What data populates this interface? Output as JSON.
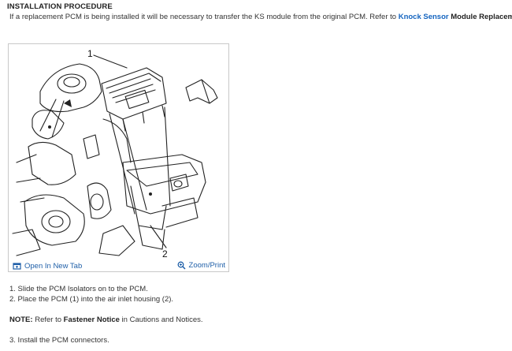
{
  "section": {
    "heading": "INSTALLATION PROCEDURE",
    "intro_text": "If a replacement PCM is being installed it will be necessary to transfer the KS module from the original PCM. Refer to ",
    "intro_link": "Knock Sensor",
    "intro_bold_suffix": " Module Replacement",
    "intro_end": "."
  },
  "figure": {
    "callout_1": "1",
    "callout_2": "2",
    "open_new_tab_label": "Open In New Tab",
    "zoom_print_label": "Zoom/Print",
    "open_icon": "open-in-new-tab-icon",
    "zoom_icon": "magnifier-zoom-icon"
  },
  "steps": [
    "1. Slide the PCM Isolators on to the PCM.",
    "2. Place the PCM (1) into the air inlet housing (2)."
  ],
  "note": {
    "prefix": "NOTE:",
    "text1": " Refer to ",
    "bold_ref": "Fastener Notice",
    "text2": " in Cautions and Notices."
  },
  "step3": "3. Install the PCM connectors.",
  "colors": {
    "link": "#1565c0",
    "footer_link": "#1f5fa8",
    "text": "#333333"
  }
}
